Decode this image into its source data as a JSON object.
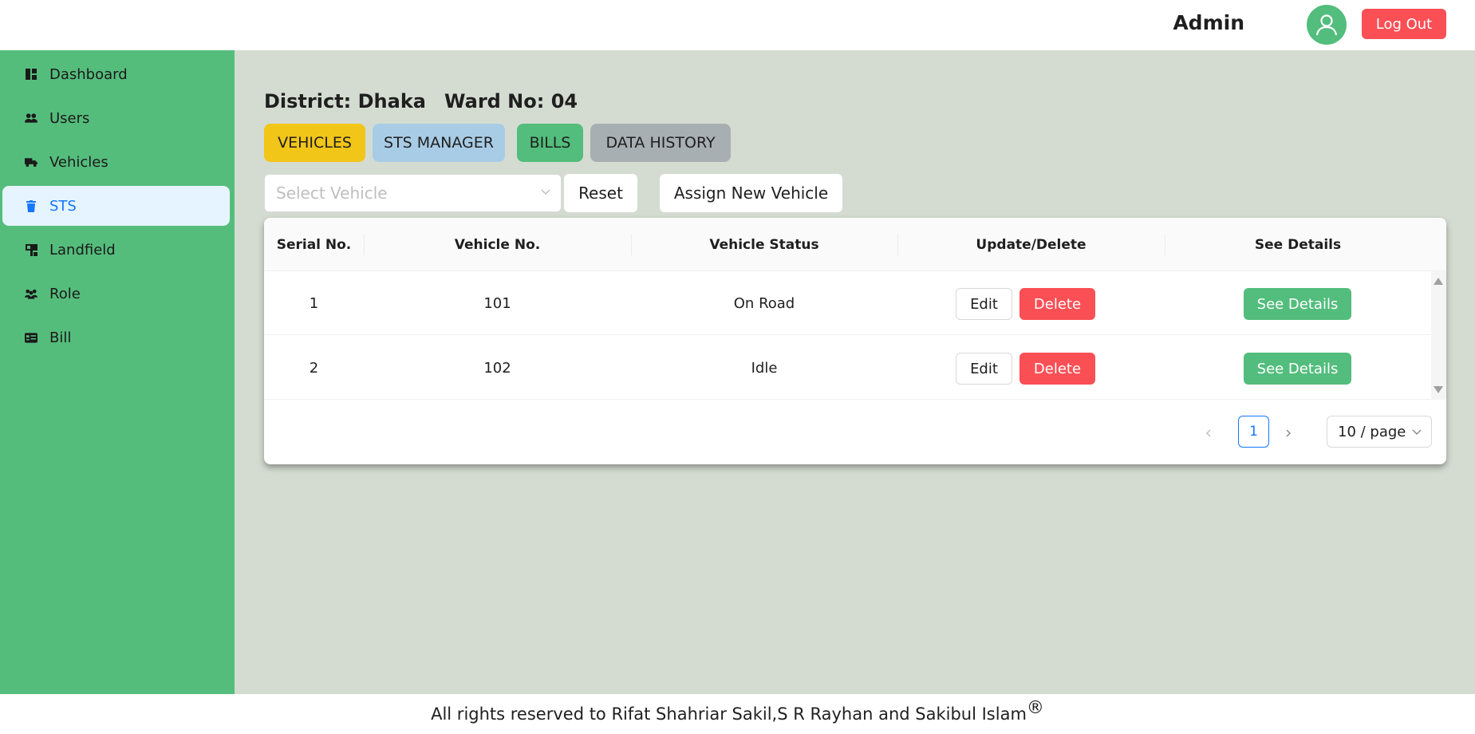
{
  "header": {
    "user_label": "Admin",
    "logout_label": "Log Out",
    "avatar_icon": "user-icon",
    "colors": {
      "avatar": "#52bd7c",
      "logout": "#fa4f55"
    }
  },
  "sidebar": {
    "items": [
      {
        "label": "Dashboard",
        "icon": "dashboard-icon"
      },
      {
        "label": "Users",
        "icon": "users-icon"
      },
      {
        "label": "Vehicles",
        "icon": "truck-icon"
      },
      {
        "label": "STS",
        "icon": "trash-bin-icon",
        "active": true
      },
      {
        "label": "Landfield",
        "icon": "landfield-icon"
      },
      {
        "label": "Role",
        "icon": "role-icon"
      },
      {
        "label": "Bill",
        "icon": "bill-icon"
      }
    ],
    "colors": {
      "background": "#55bd7c",
      "active_bg": "#e6f4ff",
      "active_text": "#1677ff"
    }
  },
  "main": {
    "district": "District: Dhaka",
    "ward": "Ward No: 04",
    "tabs": [
      {
        "label": "VEHICLES",
        "color": "#f2c519"
      },
      {
        "label": "STS MANAGER",
        "color": "#a9cce6"
      },
      {
        "label": "BILLS",
        "color": "#52bd7c"
      },
      {
        "label": "DATA HISTORY",
        "color": "#a8afb3"
      }
    ],
    "select_placeholder": "Select Vehicle",
    "reset_label": "Reset",
    "assign_label": "Assign New Vehicle"
  },
  "table": {
    "columns": [
      "Serial No.",
      "Vehicle No.",
      "Vehicle Status",
      "Update/Delete",
      "See Details"
    ],
    "rows": [
      {
        "serial": "1",
        "vehicle_no": "101",
        "status": "On Road"
      },
      {
        "serial": "2",
        "vehicle_no": "102",
        "status": "Idle"
      }
    ],
    "edit_label": "Edit",
    "delete_label": "Delete",
    "details_label": "See Details"
  },
  "pagination": {
    "current_page": "1",
    "page_size": "10 / page"
  },
  "footer": {
    "text": "All rights reserved to Rifat Shahriar Sakil,S R Rayhan and Sakibul Islam",
    "mark": "®"
  }
}
